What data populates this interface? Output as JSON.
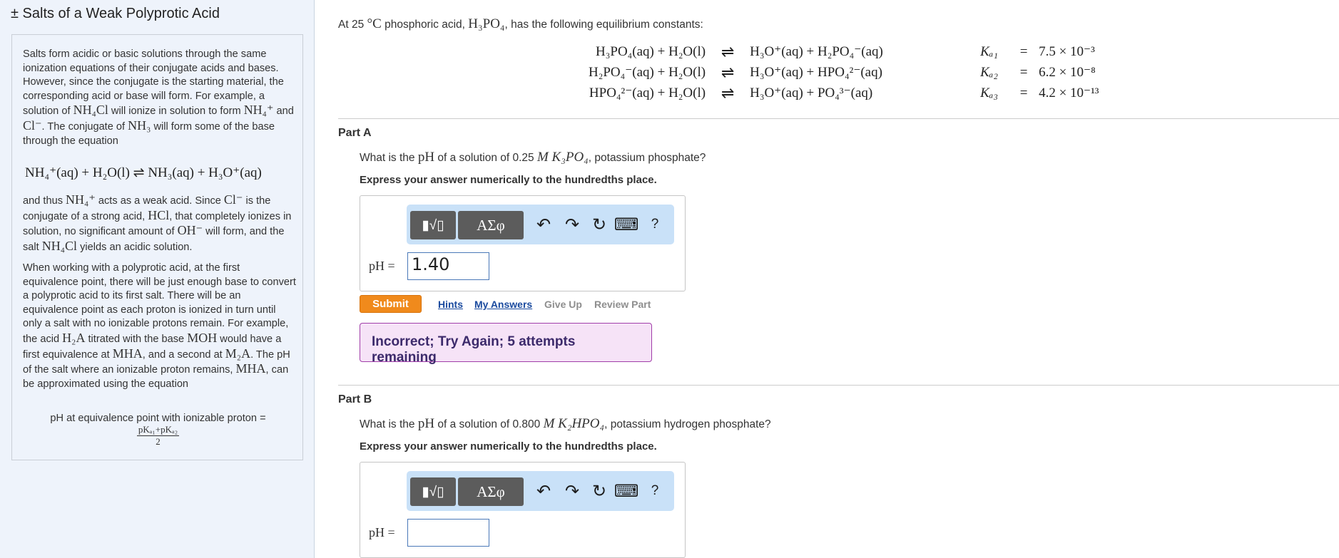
{
  "sidebar": {
    "title": "± Salts of a Weak Polyprotic Acid",
    "para1": {
      "t1": "Salts form acidic or basic solutions through the same ionization equations of their conjugate acids and bases. However, since the conjugate is the starting material, the corresponding acid or base will form. For example, a solution of ",
      "nh4cl": "NH₄Cl",
      "t2": " will ionize in solution to form ",
      "nh4p": "NH₄⁺",
      "t3": " and ",
      "clm": "Cl⁻",
      "t4": ". The conjugate of ",
      "nh3": "NH₃",
      "t5": " will form some of the base through the equation"
    },
    "equation": "NH₄⁺(aq) + H₂O(l) ⇌ NH₃(aq) + H₃O⁺(aq)",
    "para2": {
      "t1": "and thus ",
      "nh4p": "NH₄⁺",
      "t2": " acts as a weak acid. Since ",
      "clm": "Cl⁻",
      "t3": " is the conjugate of a strong acid, ",
      "hcl": "HCl",
      "t4": ", that completely ionizes in solution, no significant amount of ",
      "ohm": "OH⁻",
      "t5": " will form, and the salt ",
      "nh4cl": "NH₄Cl",
      "t6": " yields an acidic solution."
    },
    "para3": {
      "t1": "When working with a polyprotic acid, at the first equivalence point, there will be just enough base to convert a polyprotic acid to its first salt. There will be an equivalence point as each proton is ionized in turn until only a salt with no ionizable protons remain. For example, the acid ",
      "h2a": "H₂A",
      "t2": " titrated with the base ",
      "moh": "MOH",
      "t3": " would have a first equivalence at ",
      "mha": "MHA",
      "t4": ", and a second at ",
      "m2a": "M₂A",
      "t5": ". The pH of the salt where an ionizable proton remains, ",
      "mha2": "MHA",
      "t6": ", can be approximated using the equation"
    },
    "ph_eq": {
      "label": "pH at equivalence point with ionizable proton =",
      "numerator": "pKₐ₁+pKₐ₂",
      "denominator": "2"
    }
  },
  "main": {
    "intro": {
      "t1": "At 25 ",
      "deg": "°C",
      "t2": " phosphoric acid, ",
      "acid": "H₃PO₄",
      "t3": ", has the following equilibrium constants:"
    },
    "equilibria": [
      {
        "lhs": "H₃PO₄(aq) + H₂O(l)",
        "arrow": "⇌",
        "rhs": "H₃O⁺(aq) + H₂PO₄⁻(aq)",
        "k": "Kₐ₁",
        "eq": "=",
        "value": "7.5 × 10⁻³"
      },
      {
        "lhs": "H₂PO₄⁻(aq) + H₂O(l)",
        "arrow": "⇌",
        "rhs": "H₃O⁺(aq) + HPO₄²⁻(aq)",
        "k": "Kₐ₂",
        "eq": "=",
        "value": "6.2 × 10⁻⁸"
      },
      {
        "lhs": "HPO₄²⁻(aq) + H₂O(l)",
        "arrow": "⇌",
        "rhs": "H₃O⁺(aq) + PO₄³⁻(aq)",
        "k": "Kₐ₃",
        "eq": "=",
        "value": "4.2 × 10⁻¹³"
      }
    ],
    "partA": {
      "title": "Part A",
      "question": {
        "t1": "What is the ",
        "ph": "pH",
        "t2": " of a solution of 0.25 ",
        "conc": "M K₃PO₄",
        "t3": ", potassium phosphate?"
      },
      "express": "Express your answer numerically to the hundredths place.",
      "toolbar": {
        "templates": "▮√▯",
        "symbols": "ΑΣφ",
        "undo": "↶",
        "redo": "↷",
        "reset": "↻",
        "keyboard": "⌨",
        "help": "?"
      },
      "ph_label": "pH =",
      "answer": "1.40",
      "submit": "Submit",
      "hints": "Hints",
      "my_answers": "My Answers",
      "give_up": "Give Up",
      "review": "Review Part",
      "feedback": "Incorrect; Try Again; 5 attempts remaining"
    },
    "partB": {
      "title": "Part B",
      "question": {
        "t1": "What is the ",
        "ph": "pH",
        "t2": " of a solution of 0.800 ",
        "conc": "M K₂HPO₄",
        "t3": ", potassium hydrogen phosphate?"
      },
      "express": "Express your answer numerically to the hundredths place.",
      "toolbar": {
        "templates": "▮√▯",
        "symbols": "ΑΣφ",
        "undo": "↶",
        "redo": "↷",
        "reset": "↻",
        "keyboard": "⌨",
        "help": "?"
      },
      "ph_label": "pH =",
      "answer": ""
    }
  },
  "colors": {
    "submit": "#f08a1c",
    "link": "#1a4a9e",
    "feedback_bg": "#f6e3f7",
    "feedback_border": "#a13ea9",
    "toolbar_bg": "#c9e1f8",
    "sidebar_bg": "#eef3fb"
  }
}
